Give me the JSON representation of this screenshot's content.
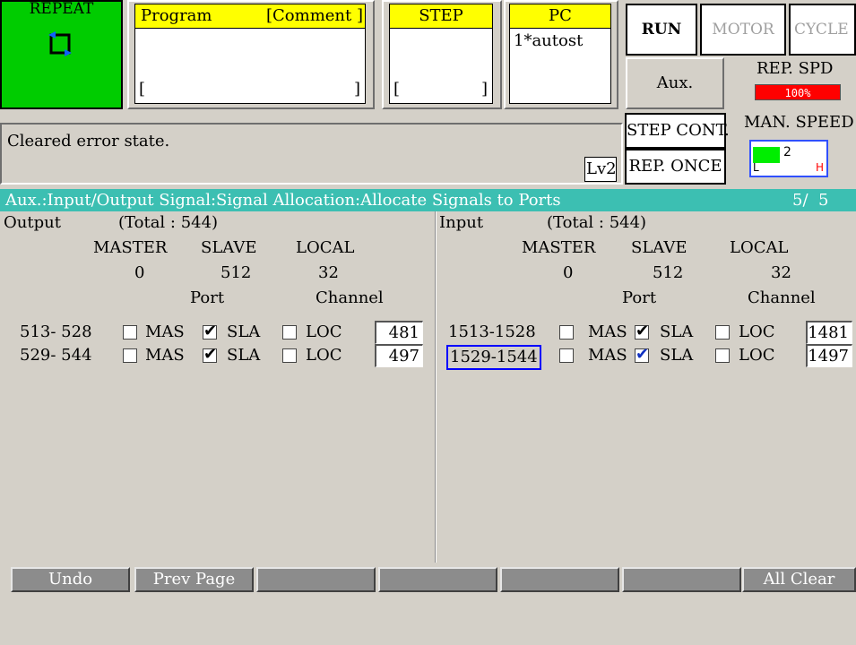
{
  "top": {
    "repeat": {
      "label": "REPEAT",
      "icon": "repeat-icon"
    },
    "program": {
      "label": "Program",
      "comment_label": "[Comment ]",
      "bracket_left": "[",
      "bracket_right": "]"
    },
    "step": {
      "label": "STEP",
      "bracket_left": "[",
      "bracket_right": "]"
    },
    "pc": {
      "label": "PC",
      "value": "1*autost"
    },
    "run_label": "RUN",
    "motor_label": "MOTOR",
    "cycle_label": "CYCLE",
    "aux_label": "Aux.",
    "rep_spd_label": "REP. SPD",
    "rep_spd_value": "100%",
    "step_cont_label": "STEP CONT.",
    "rep_once_label": "REP. ONCE",
    "man_speed_label": "MAN. SPEED",
    "man_speed_value": "2",
    "man_speed_low": "L",
    "man_speed_high": "H",
    "level": "Lv2"
  },
  "message": "Cleared error state.",
  "title_bar": {
    "text": "Aux.:Input/Output Signal:Signal Allocation:Allocate Signals to Ports",
    "page": "5/  5"
  },
  "output": {
    "label": "Output",
    "total": "(Total : 544)",
    "headers": {
      "master": "MASTER",
      "slave": "SLAVE",
      "local": "LOCAL"
    },
    "counts": {
      "master": "0",
      "slave": "512",
      "local": "32"
    },
    "port_label": "Port",
    "channel_label": "Channel",
    "rows": [
      {
        "range": "513- 528",
        "mas": "MAS",
        "sla": "SLA",
        "loc": "LOC",
        "checked": "SLA",
        "channel": "481"
      },
      {
        "range": "529- 544",
        "mas": "MAS",
        "sla": "SLA",
        "loc": "LOC",
        "checked": "SLA",
        "channel": "497"
      }
    ]
  },
  "input": {
    "label": "Input",
    "total": "(Total : 544)",
    "headers": {
      "master": "MASTER",
      "slave": "SLAVE",
      "local": "LOCAL"
    },
    "counts": {
      "master": "0",
      "slave": "512",
      "local": "32"
    },
    "port_label": "Port",
    "channel_label": "Channel",
    "rows": [
      {
        "range": "1513-1528",
        "mas": "MAS",
        "sla": "SLA",
        "loc": "LOC",
        "checked": "SLA",
        "channel": "1481"
      },
      {
        "range": "1529-1544",
        "mas": "MAS",
        "sla": "SLA",
        "loc": "LOC",
        "checked": "SLA",
        "channel": "1497",
        "selected": true
      }
    ]
  },
  "function_keys": [
    "Undo",
    "Prev Page",
    "",
    "",
    "",
    "",
    "All Clear"
  ],
  "colors": {
    "title_bar": "#3cbfb2",
    "repeat_bg": "#00d000",
    "yellow_label": "#ffff00",
    "speed_bar": "#ff0000",
    "selection": "#0000ff"
  }
}
